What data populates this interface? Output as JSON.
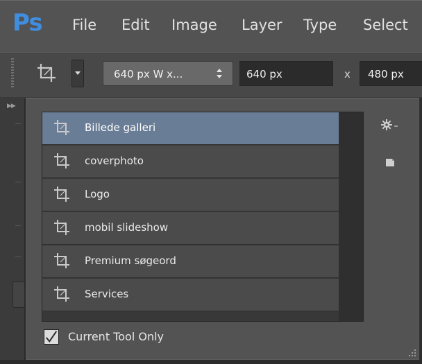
{
  "menubar": {
    "logo": "Ps",
    "items": [
      "File",
      "Edit",
      "Image",
      "Layer",
      "Type",
      "Select"
    ]
  },
  "options_bar": {
    "tool_icon": "crop-tool-icon",
    "preset_value": "640 px W x...",
    "width_value": "640 px",
    "times_sign": "x",
    "height_value": "480 px"
  },
  "preset_picker": {
    "items": [
      {
        "label": "Billede galleri",
        "selected": true
      },
      {
        "label": "coverphoto",
        "selected": false
      },
      {
        "label": "Logo",
        "selected": false
      },
      {
        "label": "mobil slideshow",
        "selected": false
      },
      {
        "label": "Premium søgeord",
        "selected": false
      },
      {
        "label": "Services",
        "selected": false
      }
    ],
    "current_tool_only_label": "Current Tool Only",
    "current_tool_only_checked": true
  },
  "colors": {
    "logo_blue": "#3f8ee0",
    "selection": "#6a7d96"
  }
}
